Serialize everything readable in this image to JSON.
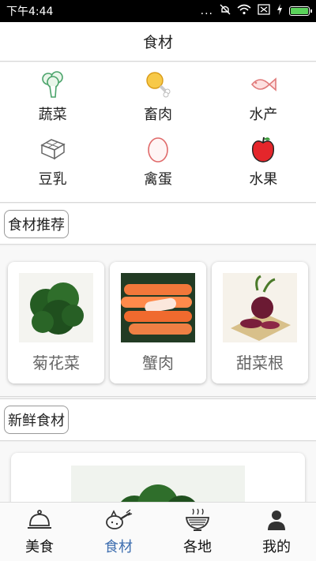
{
  "status_bar": {
    "time": "下午4:44",
    "dots": "...",
    "battery_percent": 100
  },
  "header": {
    "title": "食材"
  },
  "categories": [
    {
      "label": "蔬菜",
      "icon": "broccoli-icon"
    },
    {
      "label": "畜肉",
      "icon": "drumstick-icon"
    },
    {
      "label": "水产",
      "icon": "fish-icon"
    },
    {
      "label": "豆乳",
      "icon": "tofu-icon"
    },
    {
      "label": "禽蛋",
      "icon": "egg-icon"
    },
    {
      "label": "水果",
      "icon": "apple-icon"
    }
  ],
  "recommend": {
    "title": "食材推荐",
    "items": [
      {
        "label": "菊花菜"
      },
      {
        "label": "蟹肉"
      },
      {
        "label": "甜菜根"
      }
    ]
  },
  "fresh": {
    "title": "新鲜食材"
  },
  "tabs": [
    {
      "label": "美食",
      "icon": "cloche-icon",
      "active": false
    },
    {
      "label": "食材",
      "icon": "vegetables-icon",
      "active": true
    },
    {
      "label": "各地",
      "icon": "noodle-bowl-icon",
      "active": false
    },
    {
      "label": "我的",
      "icon": "person-icon",
      "active": false
    }
  ],
  "colors": {
    "active_tab": "#3f6fb0",
    "battery": "#5bd35b"
  }
}
